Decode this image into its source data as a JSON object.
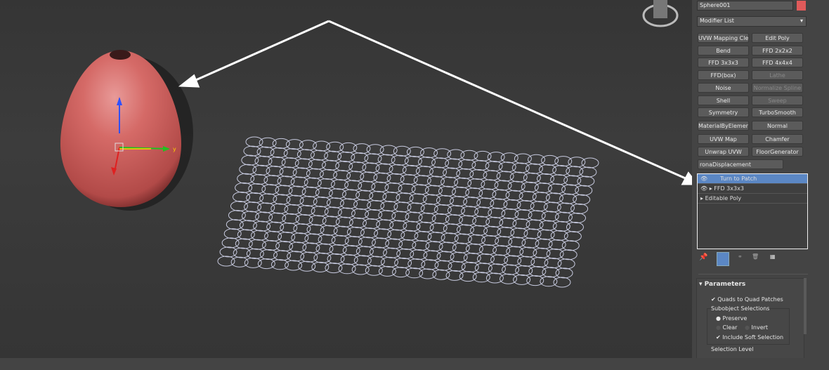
{
  "object_name": "Sphere001",
  "object_color": "#e05a5a",
  "modifier_list": "Modifier List",
  "buttons": [
    {
      "label": "UVW Mapping Clear",
      "enabled": true
    },
    {
      "label": "Edit Poly",
      "enabled": true
    },
    {
      "label": "Bend",
      "enabled": true
    },
    {
      "label": "FFD 2x2x2",
      "enabled": true
    },
    {
      "label": "FFD 3x3x3",
      "enabled": true
    },
    {
      "label": "FFD 4x4x4",
      "enabled": true
    },
    {
      "label": "FFD(box)",
      "enabled": true
    },
    {
      "label": "Lathe",
      "enabled": false
    },
    {
      "label": "Noise",
      "enabled": true
    },
    {
      "label": "Normalize Spline",
      "enabled": false
    },
    {
      "label": "Shell",
      "enabled": true
    },
    {
      "label": "Sweep",
      "enabled": false
    },
    {
      "label": "Symmetry",
      "enabled": true
    },
    {
      "label": "TurboSmooth",
      "enabled": true
    },
    {
      "label": "MaterialByElement",
      "enabled": true
    },
    {
      "label": "Normal",
      "enabled": true
    },
    {
      "label": "UVW Map",
      "enabled": true
    },
    {
      "label": "Chamfer",
      "enabled": true
    },
    {
      "label": "Unwrap UVW",
      "enabled": true
    },
    {
      "label": "FloorGenerator",
      "enabled": true
    },
    {
      "label": "ronaDisplacement",
      "enabled": true
    }
  ],
  "stack": [
    {
      "label": "Turn to Patch",
      "selected": true,
      "eye": true,
      "expand": false
    },
    {
      "label": "FFD 3x3x3",
      "selected": false,
      "eye": true,
      "expand": true
    },
    {
      "label": "Editable Poly",
      "selected": false,
      "eye": false,
      "expand": true
    }
  ],
  "parameters": {
    "title": "Parameters",
    "quads": "Quads to Quad Patches",
    "subobject": "Subobject Selections",
    "preserve": "Preserve",
    "clear": "Clear",
    "invert": "Invert",
    "soft": "Include Soft Selection",
    "level": "Selection Level"
  },
  "axis_y": "y"
}
